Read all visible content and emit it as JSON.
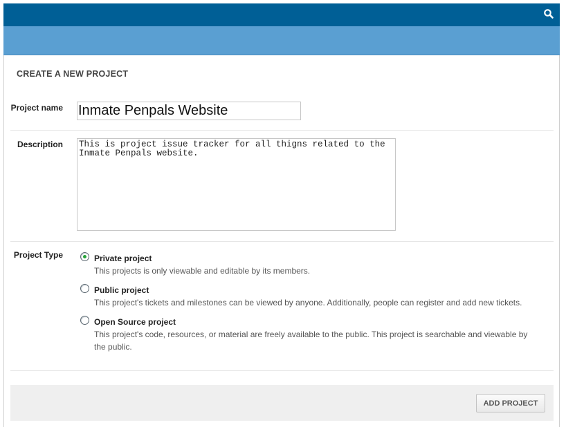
{
  "header": {
    "search_icon": "search-icon",
    "bar_color": "#005f96",
    "subbar_color": "#5a9fd2"
  },
  "page": {
    "title": "CREATE A NEW PROJECT"
  },
  "form": {
    "project_name_label": "Project name",
    "project_name_value": "Inmate Penpals Website",
    "description_label": "Description",
    "description_value": "This is project issue tracker for all thigns related to the Inmate Penpals website.",
    "project_type_label": "Project Type",
    "project_types": [
      {
        "title": "Private project",
        "description": "This projects is only viewable and editable by its members.",
        "selected": true
      },
      {
        "title": "Public project",
        "description": "This project's tickets and milestones can be viewed by anyone. Additionally, people can register and add new tickets.",
        "selected": false
      },
      {
        "title": "Open Source project",
        "description": "This project's code, resources, or material are freely available to the public. This project is searchable and viewable by the public.",
        "selected": false
      }
    ],
    "submit_label": "ADD PROJECT"
  }
}
